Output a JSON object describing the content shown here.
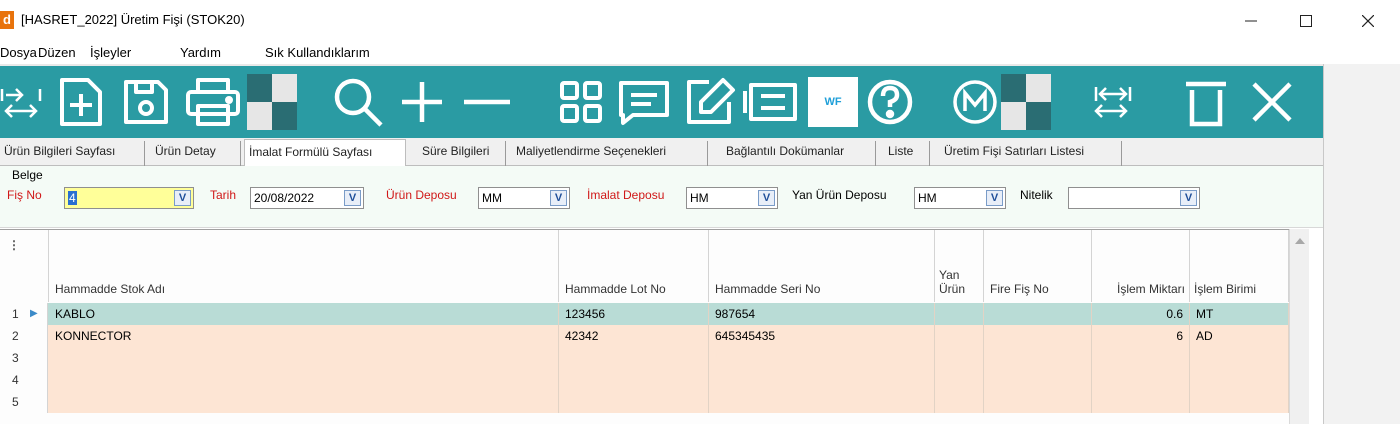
{
  "window": {
    "app_icon_letter": "d",
    "title": "[HASRET_2022] Üretim Fişi (STOK20)"
  },
  "menu": [
    "Dosya",
    "Düzen",
    "İşleyler",
    "Yardım",
    "Sık Kullandıklarım"
  ],
  "toolbar": {
    "wf_label": "WF",
    "m_label": "M",
    "icons": [
      "expand-arrows-icon",
      "new-document-icon",
      "save-icon",
      "print-icon",
      "search-icon",
      "add-icon",
      "remove-icon",
      "grid-view-icon",
      "comment-icon",
      "edit-icon",
      "list-icon",
      "workflow-icon",
      "help-icon",
      "m-icon",
      "collapse-arrows-icon",
      "delete-icon",
      "close-icon"
    ]
  },
  "tabs": [
    "Ürün Bilgileri Sayfası",
    "Ürün Detay",
    "İmalat Formülü Sayfası",
    "Süre Bilgileri",
    "Maliyetlendirme Seçenekleri",
    "Bağlantılı Dokümanlar",
    "Liste",
    "Üretim Fişi Satırları Listesi"
  ],
  "active_tab": "İmalat Formülü Sayfası",
  "form": {
    "belge_label": "Belge",
    "fis_no_label": "Fiş No",
    "fis_no_value": "4",
    "tarih_label": "Tarih",
    "tarih_value": "20/08/2022",
    "urun_deposu_label": "Ürün Deposu",
    "urun_deposu_value": "MM",
    "imalat_deposu_label": "İmalat Deposu",
    "imalat_deposu_value": "HM",
    "yan_urun_deposu_label": "Yan Ürün Deposu",
    "yan_urun_deposu_value": "HM",
    "nitelik_label": "Nitelik",
    "nitelik_value": "",
    "dropdown_glyph": "V"
  },
  "grid": {
    "menu_glyph": "⋮",
    "columns": {
      "stok_adi": "Hammadde Stok Adı",
      "lot_no": "Hammadde Lot No",
      "seri_no": "Hammadde Seri No",
      "yan_urun_1": "Yan",
      "yan_urun_2": "Ürün",
      "fire_fis_no": "Fire Fiş No",
      "islem_miktari": "İşlem Miktarı",
      "islem_birimi": "İşlem Birimi"
    },
    "rows": [
      {
        "num": "1",
        "stok_adi": "KABLO",
        "lot_no": "123456",
        "seri_no": "987654",
        "yan_urun": "",
        "fire_fis_no": "",
        "islem_miktari": "0.6",
        "islem_birimi": "MT"
      },
      {
        "num": "2",
        "stok_adi": "KONNECTOR",
        "lot_no": "42342",
        "seri_no": "645345435",
        "yan_urun": "",
        "fire_fis_no": "",
        "islem_miktari": "6",
        "islem_birimi": "AD"
      },
      {
        "num": "3",
        "stok_adi": "",
        "lot_no": "",
        "seri_no": "",
        "yan_urun": "",
        "fire_fis_no": "",
        "islem_miktari": "",
        "islem_birimi": ""
      },
      {
        "num": "4",
        "stok_adi": "",
        "lot_no": "",
        "seri_no": "",
        "yan_urun": "",
        "fire_fis_no": "",
        "islem_miktari": "",
        "islem_birimi": ""
      },
      {
        "num": "5",
        "stok_adi": "",
        "lot_no": "",
        "seri_no": "",
        "yan_urun": "",
        "fire_fis_no": "",
        "islem_miktari": "",
        "islem_birimi": ""
      }
    ]
  },
  "colors": {
    "toolbar_bg": "#2a9ba3",
    "selected_row": "#b9dcd6",
    "row_bg": "#fde5d4",
    "required_label": "#d01818"
  }
}
